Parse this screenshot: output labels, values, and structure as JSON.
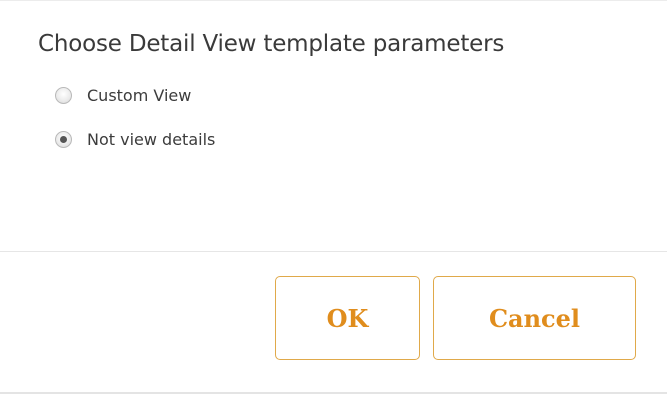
{
  "dialog": {
    "title": "Choose Detail View template parameters",
    "options": [
      {
        "label": "Custom View",
        "selected": false
      },
      {
        "label": "Not view details",
        "selected": true
      }
    ],
    "ok_label": "OK",
    "cancel_label": "Cancel"
  },
  "colors": {
    "button_text": "#e08d1d",
    "button_border": "#e0a94a",
    "text": "#3a3a3a"
  }
}
